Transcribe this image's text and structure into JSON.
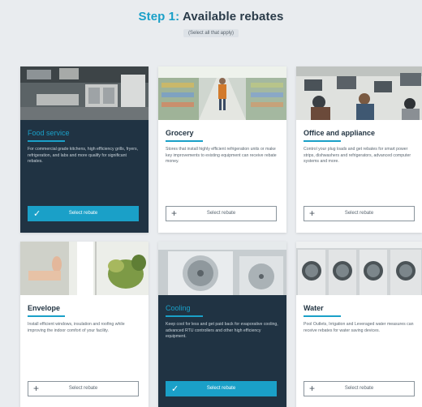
{
  "header": {
    "step_label": "Step 1:",
    "title": "Available rebates",
    "subtitle": "(Select all that apply)"
  },
  "colors": {
    "accent": "#1aa0c8",
    "selected_card": "#203343",
    "page_background": "#e9ecef"
  },
  "cards": [
    {
      "title": "Food service",
      "description": "For commercial grade kitchens, high efficiency grills, fryers, refrigeration, and labs and more qualify for significant rebates.",
      "button_label": "Select rebate",
      "selected": true,
      "button_icon": "check-icon"
    },
    {
      "title": "Grocery",
      "description": "Stores that install highly efficient refrigeration units or make key improvements to existing equipment can receive rebate money.",
      "button_label": "Select rebate",
      "selected": false,
      "button_icon": "plus-icon"
    },
    {
      "title": "Office and appliance",
      "description": "Control your plug loads and get rebates for smart power strips, dishwashers and refrigerators, advanced computer systems and more.",
      "button_label": "Select rebate",
      "selected": false,
      "button_icon": "plus-icon"
    },
    {
      "title": "Envelope",
      "description": "Install efficient windows, insulation and roofing while improving the indoor comfort of your facility.",
      "button_label": "Select rebate",
      "selected": false,
      "button_icon": "plus-icon"
    },
    {
      "title": "Cooling",
      "description": "Keep cool for less and get paid back for evaporative cooling, advanced RTU controllers and other high efficiency equipment.",
      "button_label": "Select rebate",
      "selected": true,
      "button_icon": "check-icon"
    },
    {
      "title": "Water",
      "description": "Pool Outlets, Irrigation and Leveraged water measures can receive rebates for water saving devices.",
      "button_label": "Select rebate",
      "selected": false,
      "button_icon": "plus-icon"
    }
  ]
}
